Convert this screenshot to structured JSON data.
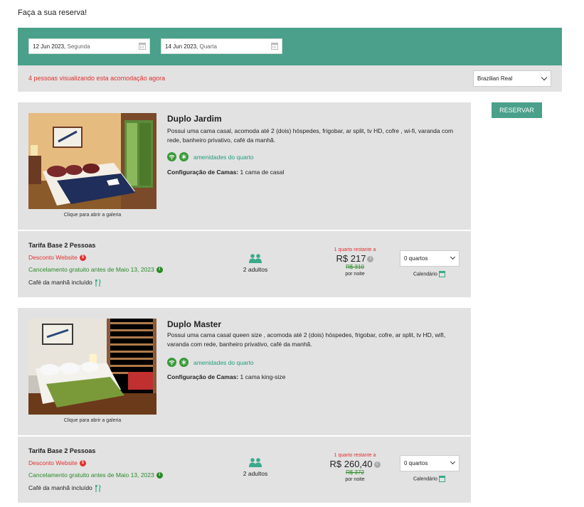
{
  "page_title": "Faça a sua reserva!",
  "dates": {
    "checkin": {
      "date": "12 Jun 2023,",
      "day": "Segunda"
    },
    "checkout": {
      "date": "14 Jun 2023,",
      "day": "Quarta"
    }
  },
  "viewers_text": "4 pessoas visualizando esta acomodação agora",
  "currency": "Brazilian Real",
  "reserve_label": "RESERVAR",
  "rooms": [
    {
      "name": "Duplo Jardim",
      "description": "Possui uma cama casal, acomoda até 2 (dois) hóspedes, frigobar, ar split, tv HD, cofre , wi-fi, varanda com rede, banheiro privativo, café da manhã.",
      "gallery_caption": "Clique para abrir a galeria",
      "amenities_label": "amenidades do quarto",
      "amenity_icons": [
        "wifi-icon",
        "snowflake-icon"
      ],
      "beds_label": "Configuração de Camas:",
      "beds_value": "1 cama de casal",
      "rate": {
        "name": "Tarifa Base 2 Pessoas",
        "discount": "Desconto Website",
        "discount_badge": "$",
        "cancellation": "Cancelamento gratuito antes de Maio 13, 2023",
        "cancellation_badge": "i",
        "breakfast": "Café da manhã incluído",
        "guests": "2 adultos",
        "rooms_left": "1 quarto restante a",
        "price": "R$ 217",
        "price_info": "i",
        "old_price": "R$ 310",
        "per_night": "por noite",
        "rooms_select": "0 quartos",
        "calendar_label": "Calendário"
      }
    },
    {
      "name": "Duplo Master",
      "description": "Possui uma cama casal queen size , acomoda até 2 (dois) hóspedes, frigobar, cofre, ar split, tv HD, wifi, varanda com rede, banheiro privativo, café da manhã.",
      "gallery_caption": "Clique para abrir a galeria",
      "amenities_label": "amenidades do quarto",
      "amenity_icons": [
        "wifi-icon",
        "snowflake-icon"
      ],
      "beds_label": "Configuração de Camas:",
      "beds_value": "1 cama king-size",
      "rate": {
        "name": "Tarifa Base 2 Pessoas",
        "discount": "Desconto Website",
        "discount_badge": "$",
        "cancellation": "Cancelamento gratuito antes de Maio 13, 2023",
        "cancellation_badge": "i",
        "breakfast": "Café da manhã incluído",
        "guests": "2 adultos",
        "rooms_left": "1 quarto restante a",
        "price": "R$ 260,40",
        "price_info": "i",
        "old_price": "R$ 372",
        "per_night": "por noite",
        "rooms_select": "0 quartos",
        "calendar_label": "Calendário"
      }
    }
  ],
  "colors": {
    "accent": "#4aa08a",
    "panel": "#e2e2e2",
    "alert": "#e0312e",
    "success": "#2a8a2a"
  }
}
